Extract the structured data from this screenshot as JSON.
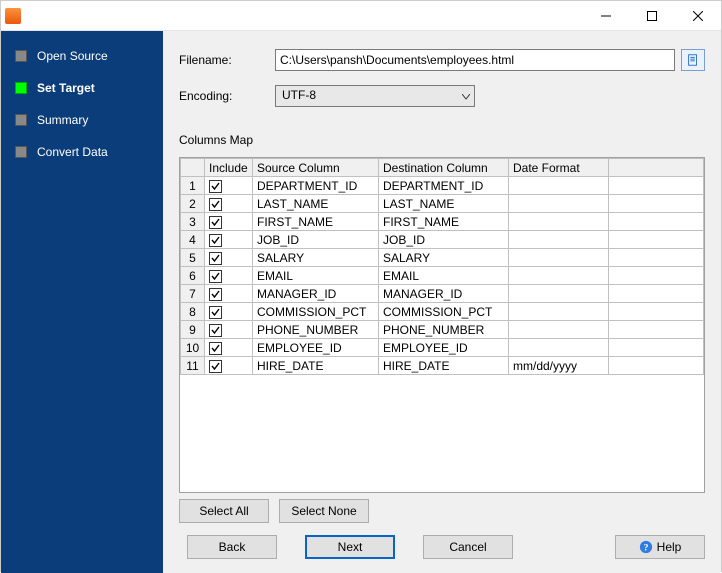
{
  "window": {
    "title": ""
  },
  "sidebar": {
    "items": [
      {
        "label": "Open Source",
        "active": false
      },
      {
        "label": "Set Target",
        "active": true
      },
      {
        "label": "Summary",
        "active": false
      },
      {
        "label": "Convert Data",
        "active": false
      }
    ]
  },
  "form": {
    "filename_label": "Filename:",
    "filename_value": "C:\\Users\\pansh\\Documents\\employees.html",
    "encoding_label": "Encoding:",
    "encoding_value": "UTF-8"
  },
  "columns_map": {
    "title": "Columns Map",
    "headers": {
      "include": "Include",
      "source": "Source Column",
      "destination": "Destination Column",
      "date_format": "Date Format"
    },
    "rows": [
      {
        "n": 1,
        "include": true,
        "source": "DEPARTMENT_ID",
        "dest": "DEPARTMENT_ID",
        "fmt": ""
      },
      {
        "n": 2,
        "include": true,
        "source": "LAST_NAME",
        "dest": "LAST_NAME",
        "fmt": ""
      },
      {
        "n": 3,
        "include": true,
        "source": "FIRST_NAME",
        "dest": "FIRST_NAME",
        "fmt": ""
      },
      {
        "n": 4,
        "include": true,
        "source": "JOB_ID",
        "dest": "JOB_ID",
        "fmt": ""
      },
      {
        "n": 5,
        "include": true,
        "source": "SALARY",
        "dest": "SALARY",
        "fmt": ""
      },
      {
        "n": 6,
        "include": true,
        "source": "EMAIL",
        "dest": "EMAIL",
        "fmt": ""
      },
      {
        "n": 7,
        "include": true,
        "source": "MANAGER_ID",
        "dest": "MANAGER_ID",
        "fmt": ""
      },
      {
        "n": 8,
        "include": true,
        "source": "COMMISSION_PCT",
        "dest": "COMMISSION_PCT",
        "fmt": ""
      },
      {
        "n": 9,
        "include": true,
        "source": "PHONE_NUMBER",
        "dest": "PHONE_NUMBER",
        "fmt": ""
      },
      {
        "n": 10,
        "include": true,
        "source": "EMPLOYEE_ID",
        "dest": "EMPLOYEE_ID",
        "fmt": ""
      },
      {
        "n": 11,
        "include": true,
        "source": "HIRE_DATE",
        "dest": "HIRE_DATE",
        "fmt": "mm/dd/yyyy"
      }
    ]
  },
  "buttons": {
    "select_all": "Select All",
    "select_none": "Select None",
    "back": "Back",
    "next": "Next",
    "cancel": "Cancel",
    "help": "Help"
  }
}
